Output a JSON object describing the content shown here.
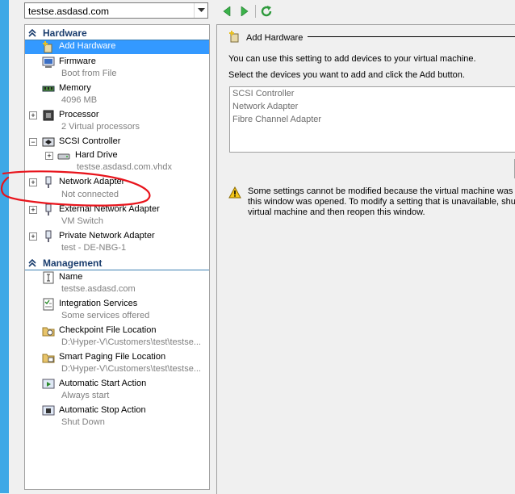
{
  "vm_selector": {
    "value": "testse.asdasd.com"
  },
  "toolbar": {
    "back_icon": "back-arrow-icon",
    "forward_icon": "forward-arrow-icon",
    "refresh_icon": "refresh-icon"
  },
  "tree": {
    "hardware_header": "Hardware",
    "management_header": "Management",
    "hardware_items": [
      {
        "label": "Add Hardware",
        "sub": ""
      },
      {
        "label": "Firmware",
        "sub": "Boot from File"
      },
      {
        "label": "Memory",
        "sub": "4096 MB"
      },
      {
        "label": "Processor",
        "sub": "2 Virtual processors"
      },
      {
        "label": "SCSI Controller",
        "sub": ""
      },
      {
        "label": "Hard Drive",
        "sub": "testse.asdasd.com.vhdx"
      },
      {
        "label": "Network Adapter",
        "sub": "Not connected"
      },
      {
        "label": "External Network Adapter",
        "sub": "VM Switch"
      },
      {
        "label": "Private Network Adapter",
        "sub": "test - DE-NBG-1"
      }
    ],
    "management_items": [
      {
        "label": "Name",
        "sub": "testse.asdasd.com"
      },
      {
        "label": "Integration Services",
        "sub": "Some services offered"
      },
      {
        "label": "Checkpoint File Location",
        "sub": "D:\\Hyper-V\\Customers\\test\\testse..."
      },
      {
        "label": "Smart Paging File Location",
        "sub": "D:\\Hyper-V\\Customers\\test\\testse..."
      },
      {
        "label": "Automatic Start Action",
        "sub": "Always start"
      },
      {
        "label": "Automatic Stop Action",
        "sub": "Shut Down"
      }
    ]
  },
  "right_panel": {
    "title": "Add Hardware",
    "intro": "You can use this setting to add devices to your virtual machine.",
    "instruction": "Select the devices you want to add and click the Add button.",
    "devices": [
      "SCSI Controller",
      "Network Adapter",
      "Fibre Channel Adapter"
    ],
    "warning_lines": [
      "Some settings cannot be modified because the virtual machine was ru",
      "this window was opened. To modify a setting that is unavailable, shu",
      "virtual machine and then reopen this window."
    ]
  },
  "colors": {
    "selected": "#3399ff",
    "header_text": "#1a3d6e",
    "sub_text": "#808080",
    "annotation": "#e8141c"
  }
}
